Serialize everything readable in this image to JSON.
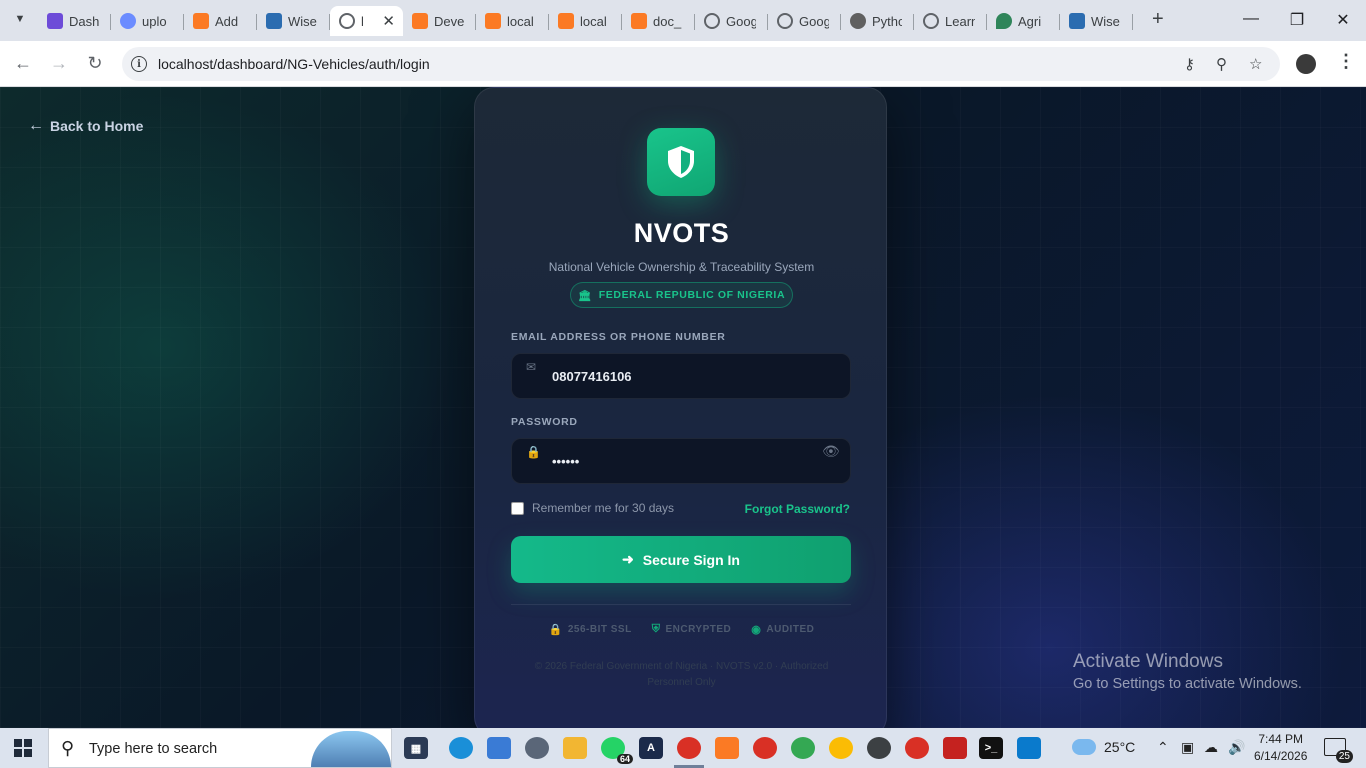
{
  "browser": {
    "tabs": [
      {
        "label": "Dash",
        "icon": "h-logo-icon",
        "cls": "h"
      },
      {
        "label": "uplo",
        "icon": "upload-icon",
        "cls": "up"
      },
      {
        "label": "Add",
        "icon": "xampp-icon",
        "cls": "xampp"
      },
      {
        "label": "Wise",
        "icon": "wise-icon",
        "cls": "wise"
      },
      {
        "label": "l",
        "icon": "globe-icon",
        "cls": "globe",
        "active": true
      },
      {
        "label": "Deve",
        "icon": "xampp-icon",
        "cls": "xampp"
      },
      {
        "label": "local",
        "icon": "xampp-icon",
        "cls": "xampp"
      },
      {
        "label": "local",
        "icon": "xampp-icon",
        "cls": "xampp"
      },
      {
        "label": "doc_",
        "icon": "xampp-icon",
        "cls": "xampp"
      },
      {
        "label": "Goog",
        "icon": "globe-icon",
        "cls": "globe"
      },
      {
        "label": "Goog",
        "icon": "globe-icon",
        "cls": "globe"
      },
      {
        "label": "Pytho",
        "icon": "python-icon",
        "cls": "py"
      },
      {
        "label": "Learn",
        "icon": "globe-icon",
        "cls": "globe"
      },
      {
        "label": "Agri",
        "icon": "agri-icon",
        "cls": "agri"
      },
      {
        "label": "Wise",
        "icon": "wise-icon",
        "cls": "wise"
      }
    ],
    "url": "localhost/dashboard/NG-Vehicles/auth/login"
  },
  "page": {
    "back_link": "Back to Home",
    "app_title": "NVOTS",
    "app_subtitle": "National Vehicle Ownership & Traceability System",
    "badge": "FEDERAL REPUBLIC OF NIGERIA",
    "email_label": "EMAIL ADDRESS OR PHONE NUMBER",
    "email_value": "08077416106",
    "password_label": "PASSWORD",
    "password_value": "••••••",
    "remember_label": "Remember me for 30 days",
    "forgot_link": "Forgot Password?",
    "signin_button": "Secure Sign In",
    "security": {
      "ssl": "256-BIT SSL",
      "encrypted": "ENCRYPTED",
      "audited": "AUDITED"
    },
    "copyright": "© 2026 Federal Government of Nigeria · NVOTS v2.0 · Authorized Personnel Only",
    "accent_color": "#19c48b"
  },
  "watermark": {
    "title": "Activate Windows",
    "subtitle": "Go to Settings to activate Windows."
  },
  "taskbar": {
    "search_placeholder": "Type here to search",
    "whatsapp_badge": "64",
    "weather": "25°C",
    "time": "7:44 PM",
    "date": "6/14/2026",
    "notifications": "25"
  }
}
